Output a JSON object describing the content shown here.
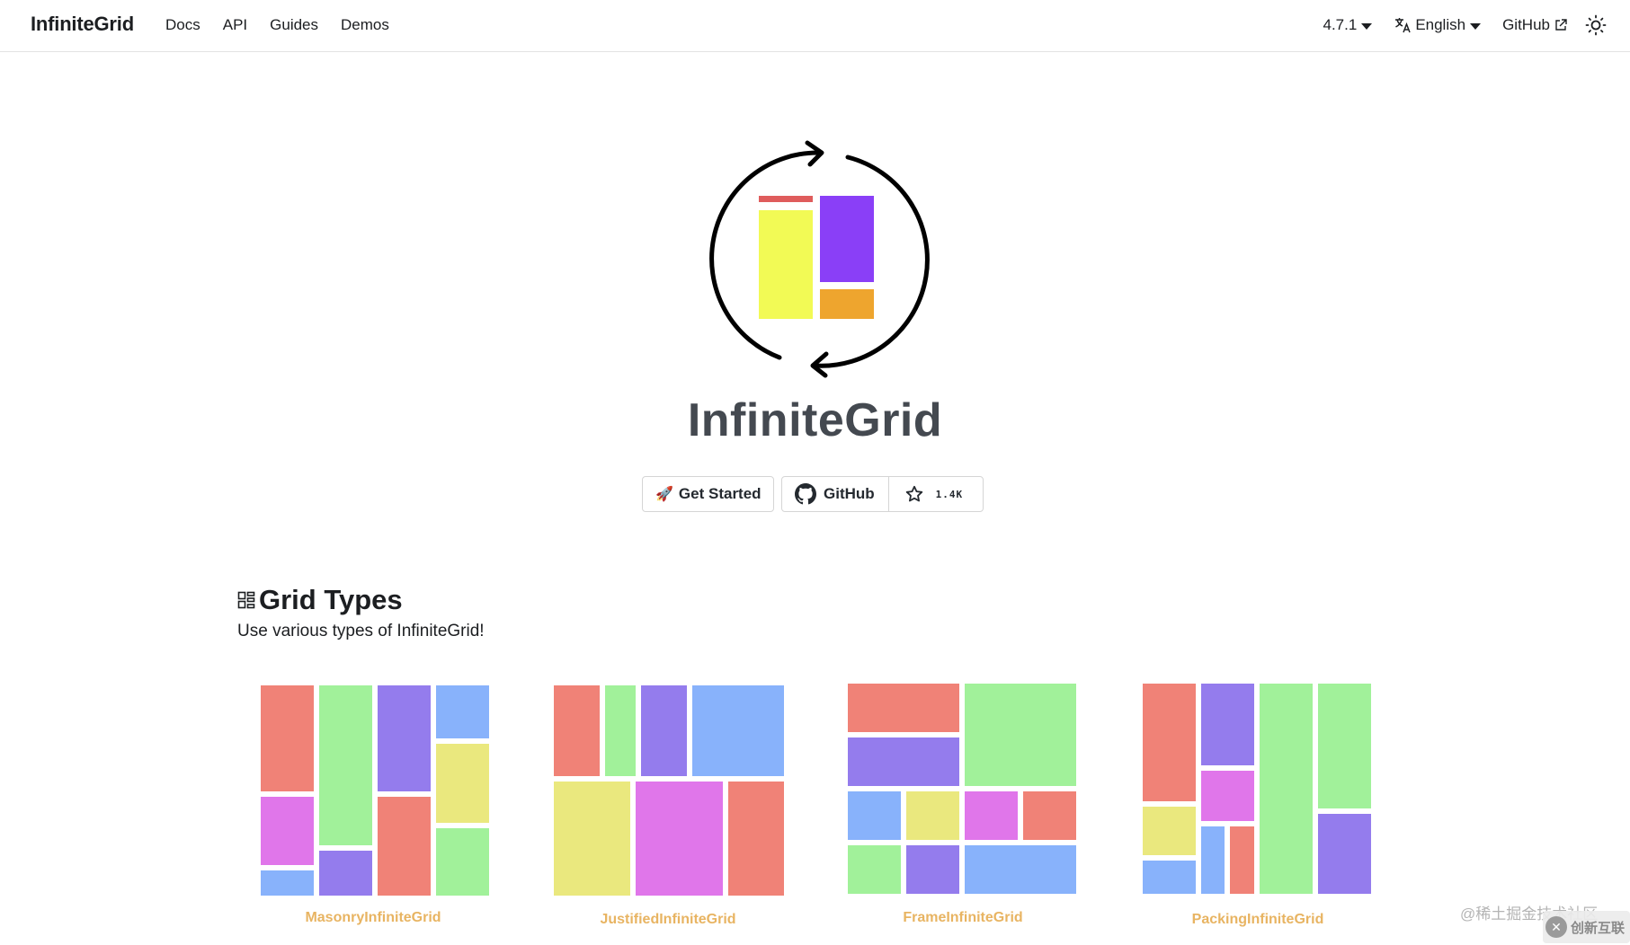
{
  "navbar": {
    "brand": "InfiniteGrid",
    "links": [
      "Docs",
      "API",
      "Guides",
      "Demos"
    ],
    "version": "4.7.1",
    "language": "English",
    "github": "GitHub"
  },
  "hero": {
    "title": "InfiniteGrid",
    "get_started": "Get Started",
    "github_button": "GitHub",
    "star_count": "1.4K"
  },
  "grid_types": {
    "title": "Grid Types",
    "subtitle": "Use various types of InfiniteGrid!",
    "cards": [
      {
        "label": "MasonryInfiniteGrid"
      },
      {
        "label": "JustifiedInfiniteGrid"
      },
      {
        "label": "FrameInfiniteGrid"
      },
      {
        "label": "PackingInfiniteGrid"
      }
    ]
  },
  "colors": {
    "red": "#f08277",
    "green": "#a1f19a",
    "purple": "#947ced",
    "blue": "#88b2fb",
    "yellow": "#eae87e",
    "pink": "#e076ea",
    "label": "#e8b462"
  },
  "watermark": {
    "text": "@稀土掘金技术社区",
    "logo_text": "创新互联"
  }
}
